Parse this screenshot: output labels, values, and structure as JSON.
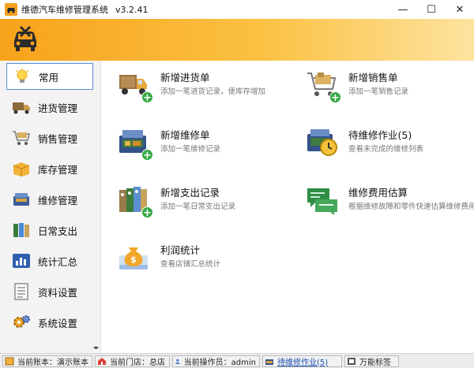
{
  "window": {
    "title": "维德汽车维修管理系统",
    "version": "v3.2.41",
    "min_glyph": "—",
    "max_glyph": "☐",
    "close_glyph": "✕"
  },
  "colors": {
    "banner_start": "#f7a21b",
    "banner_end": "#fde3a0",
    "active_border": "#5b8fd6",
    "plus_green": "#35a845",
    "link_blue": "#1a4fb5"
  },
  "sidebar": {
    "items": [
      {
        "label": "常用",
        "icon": "lightbulb-icon",
        "active": true
      },
      {
        "label": "进货管理",
        "icon": "truck-icon",
        "active": false
      },
      {
        "label": "销售管理",
        "icon": "shopping-cart-icon",
        "active": false
      },
      {
        "label": "库存管理",
        "icon": "box-icon",
        "active": false
      },
      {
        "label": "维修管理",
        "icon": "toolbox-icon",
        "active": false
      },
      {
        "label": "日常支出",
        "icon": "binders-icon",
        "active": false
      },
      {
        "label": "统计汇总",
        "icon": "chart-icon",
        "active": false
      },
      {
        "label": "资料设置",
        "icon": "document-icon",
        "active": false
      },
      {
        "label": "系统设置",
        "icon": "gears-icon",
        "active": false
      }
    ],
    "grip": "◂▸"
  },
  "tiles": [
    {
      "title": "新增进货单",
      "desc": "添加一笔进货记录，便库存增加",
      "icon": "truck-add-icon"
    },
    {
      "title": "新增销售单",
      "desc": "添加一笔销售记录",
      "icon": "cart-add-icon"
    },
    {
      "title": "新增维修单",
      "desc": "添加一笔维修记录",
      "icon": "toolbox-add-icon"
    },
    {
      "title": "待维修作业(5)",
      "desc": "查看未完成的维修列表",
      "icon": "toolbox-clock-icon"
    },
    {
      "title": "新增支出记录",
      "desc": "添加一笔日常支出记录",
      "icon": "binders-add-icon"
    },
    {
      "title": "维修费用估算",
      "desc": "根据维修故障和零件快速估算维修费用。",
      "icon": "chat-estimate-icon"
    },
    {
      "title": "利润统计",
      "desc": "查看店铺汇总统计",
      "icon": "money-bag-icon"
    }
  ],
  "statusbar": {
    "account": "当前账本：演示账本",
    "store": "当前门店：总店",
    "operator": "当前操作员：admin",
    "pending": "待维修作业(5)",
    "labels": "万能标签"
  }
}
